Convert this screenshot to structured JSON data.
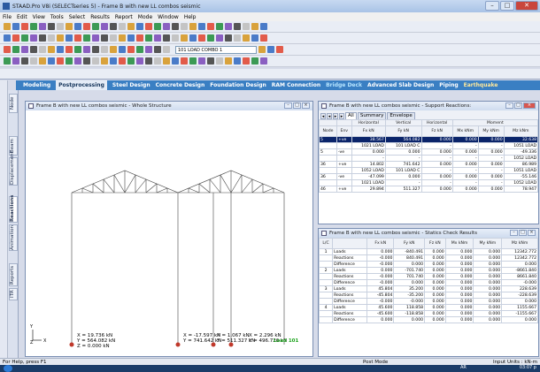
{
  "window": {
    "title": "STAAD.Pro V8i (SELECTseries 5) - Frame B with new LL combos seismic",
    "btn_min": "–",
    "btn_max": "□",
    "btn_close": "✕"
  },
  "menu": [
    "File",
    "Edit",
    "View",
    "Tools",
    "Select",
    "Results",
    "Report",
    "Mode",
    "Window",
    "Help"
  ],
  "toolbar": {
    "load_case": "101 LOAD COMBO 1"
  },
  "ribbon": {
    "tabs": [
      "Modeling",
      "Postprocessing",
      "Steel Design",
      "Concrete Design",
      "Foundation Design",
      "RAM Connection",
      "Bridge Deck",
      "Advanced Slab Design",
      "Piping",
      "Earthquake"
    ],
    "active": "Postprocessing"
  },
  "sidetabs": [
    "Node",
    "Beam",
    "Displacement",
    "Reactions",
    "Animation",
    "Reports",
    "ITR"
  ],
  "structure_window": {
    "title": "Frame B with new LL combos seismic - Whole Structure",
    "results": [
      {
        "lines": [
          "X = 19.736 kN",
          "Y = 564.082 kN",
          "Z = 0.000 kN"
        ]
      },
      {
        "lines": [
          "X = -17.597 kN",
          "Y = 741.642 kN"
        ]
      },
      {
        "lines": [
          "X = 1.067 kN",
          "Y = 511.327 kN"
        ]
      },
      {
        "lines": [
          "X = 2.296 kN",
          "Y = 496.726 kN"
        ]
      }
    ],
    "load_label": "Load 101",
    "axis_y": "Y",
    "axis_x": "X",
    "axis_z": "Z"
  },
  "support_reactions": {
    "title": "Frame B with new LL combos seismic - Support Reactions:",
    "tabs": [
      "All",
      "Summary",
      "Envelope"
    ],
    "group_headers": [
      "Horizontal",
      "Vertical",
      "Horizontal",
      "Moment"
    ],
    "columns": [
      "Node",
      "Env",
      "Fx kN",
      "Fy kN",
      "Fz kN",
      "Mx kNm",
      "My kNm",
      "Mz kNm"
    ],
    "rows": [
      [
        "5",
        "+ve",
        "38.567",
        "564.082",
        "0.000",
        "0.000",
        "0.000",
        "32.638"
      ],
      [
        "",
        "",
        "1021 LOAD",
        "101 LOAD C",
        "-",
        "-",
        "-",
        "1051 LOAD"
      ],
      [
        "5",
        "-ve",
        "0.000",
        "0.000",
        "0.000",
        "0.000",
        "0.000",
        "-49.336"
      ],
      [
        "",
        "",
        "-",
        "-",
        "-",
        "-",
        "-",
        "1052 LOAD"
      ],
      [
        "36",
        "+ve",
        "14.802",
        "741.642",
        "0.000",
        "0.000",
        "0.000",
        "86.989"
      ],
      [
        "",
        "",
        "1052 LOAD",
        "101 LOAD C",
        "-",
        "-",
        "-",
        "1051 LOAD"
      ],
      [
        "36",
        "-ve",
        "-47.099",
        "0.000",
        "0.000",
        "0.000",
        "0.000",
        "-55.146"
      ],
      [
        "",
        "",
        "1021 LOAD",
        "-",
        "-",
        "-",
        "-",
        "1052 LOAD"
      ],
      [
        "46",
        "+ve",
        "29.894",
        "511.327",
        "0.000",
        "0.000",
        "0.000",
        "78.947"
      ]
    ]
  },
  "statics_check": {
    "title": "Frame B with new LL combos seismic - Statics Check Results",
    "columns": [
      "L/C",
      "",
      "Fx kN",
      "Fy kN",
      "Fz kN",
      "Mx kNm",
      "My kNm",
      "Mz kNm"
    ],
    "rows": [
      [
        "1",
        "Loads",
        "0.000",
        "-840.491",
        "0.000",
        "0.000",
        "0.000",
        "12342.772"
      ],
      [
        "",
        "Reactions",
        "-0.000",
        "840.491",
        "0.000",
        "0.000",
        "0.000",
        "12342.772"
      ],
      [
        "",
        "Difference",
        "-0.000",
        "0.000",
        "0.000",
        "0.000",
        "0.000",
        "0.000"
      ],
      [
        "2",
        "Loads",
        "0.000",
        "-701.740",
        "0.000",
        "0.000",
        "0.000",
        "-8661.840"
      ],
      [
        "",
        "Reactions",
        "-0.000",
        "701.740",
        "0.000",
        "0.000",
        "0.000",
        "8661.840"
      ],
      [
        "",
        "Difference",
        "-0.000",
        "0.000",
        "0.000",
        "0.000",
        "0.000",
        "-0.000"
      ],
      [
        "3",
        "Loads",
        "45.804",
        "35.200",
        "0.000",
        "0.000",
        "0.000",
        "228.639"
      ],
      [
        "",
        "Reactions",
        "-45.804",
        "-35.200",
        "0.000",
        "0.000",
        "0.000",
        "-228.639"
      ],
      [
        "",
        "Difference",
        "-0.000",
        "-0.000",
        "0.000",
        "0.000",
        "0.000",
        "0.000"
      ],
      [
        "4",
        "Loads",
        "45.600",
        "118.858",
        "0.000",
        "0.000",
        "0.000",
        "1155.667"
      ],
      [
        "",
        "Reactions",
        "-45.600",
        "-118.858",
        "0.000",
        "0.000",
        "0.000",
        "-1155.667"
      ],
      [
        "",
        "Difference",
        "0.000",
        "0.000",
        "0.000",
        "0.000",
        "0.000",
        "0.000"
      ]
    ]
  },
  "status": {
    "help": "For Help, press F1",
    "mode": "Post Mode",
    "units": "Input Units : kN-m"
  },
  "taskbar": {
    "time": "03:07 p",
    "lang": "AR"
  }
}
